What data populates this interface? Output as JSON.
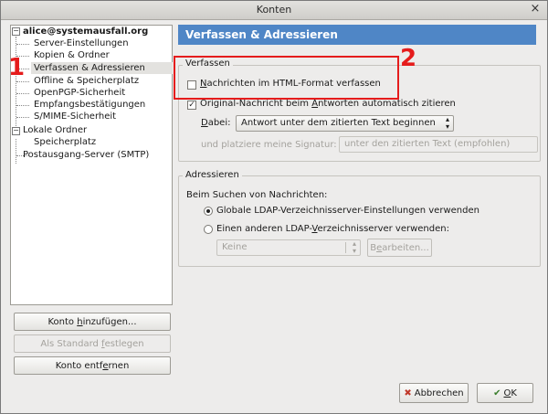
{
  "window": {
    "title": "Konten",
    "close_glyph": "×"
  },
  "tree": {
    "account": "alice@systemausfall.org",
    "account_items": [
      "Server-Einstellungen",
      "Kopien & Ordner",
      "Verfassen & Adressieren",
      "Offline & Speicherplatz",
      "OpenPGP-Sicherheit",
      "Empfangsbestätigungen",
      "S/MIME-Sicherheit"
    ],
    "local": "Lokale Ordner",
    "local_items": [
      "Speicherplatz"
    ],
    "smtp": "Postausgang-Server (SMTP)",
    "selected": "Verfassen & Adressieren"
  },
  "left_buttons": {
    "add_pre": "Konto ",
    "add_u": "h",
    "add_post": "inzufügen...",
    "default_pre": "Als Standard ",
    "default_u": "f",
    "default_post": "estlegen",
    "remove_pre": "Konto entf",
    "remove_u": "e",
    "remove_post": "rnen"
  },
  "panel": {
    "title": "Verfassen & Adressieren",
    "compose": {
      "group_title": "Verfassen",
      "html_pre": "",
      "html_u": "N",
      "html_post": "achrichten im HTML-Format verfassen",
      "html_checked": false,
      "quote_pre": "Original-Nachricht beim ",
      "quote_u": "A",
      "quote_post": "ntworten automatisch zitieren",
      "quote_checked": true,
      "then_pre": "",
      "then_u": "D",
      "then_post": "abei:",
      "then_value": "Antwort unter dem zitierten Text beginnen",
      "signature_label": "und platziere meine Signatur:",
      "signature_value": "unter den zitierten Text (empfohlen)"
    },
    "addressing": {
      "group_title": "Adressieren",
      "when_searching": "Beim Suchen von Nachrichten:",
      "global_ldap": "Globale LDAP-Verzeichnisserver-Einstellungen verwenden",
      "other_pre": "Einen anderen LDAP-",
      "other_u": "V",
      "other_post": "erzeichnisserver verwenden:",
      "selected": "global",
      "server_value": "Keine",
      "edit_pre": "B",
      "edit_u": "e",
      "edit_post": "arbeiten..."
    }
  },
  "footer": {
    "cancel": "Abbrechen",
    "ok_pre": "",
    "ok_u": "O",
    "ok_post": "K"
  },
  "annotations": {
    "first": "1",
    "second": "2",
    "color": "#e51c1c"
  },
  "colors": {
    "header": "#4f86c6",
    "highlight": "#e51c1c"
  }
}
